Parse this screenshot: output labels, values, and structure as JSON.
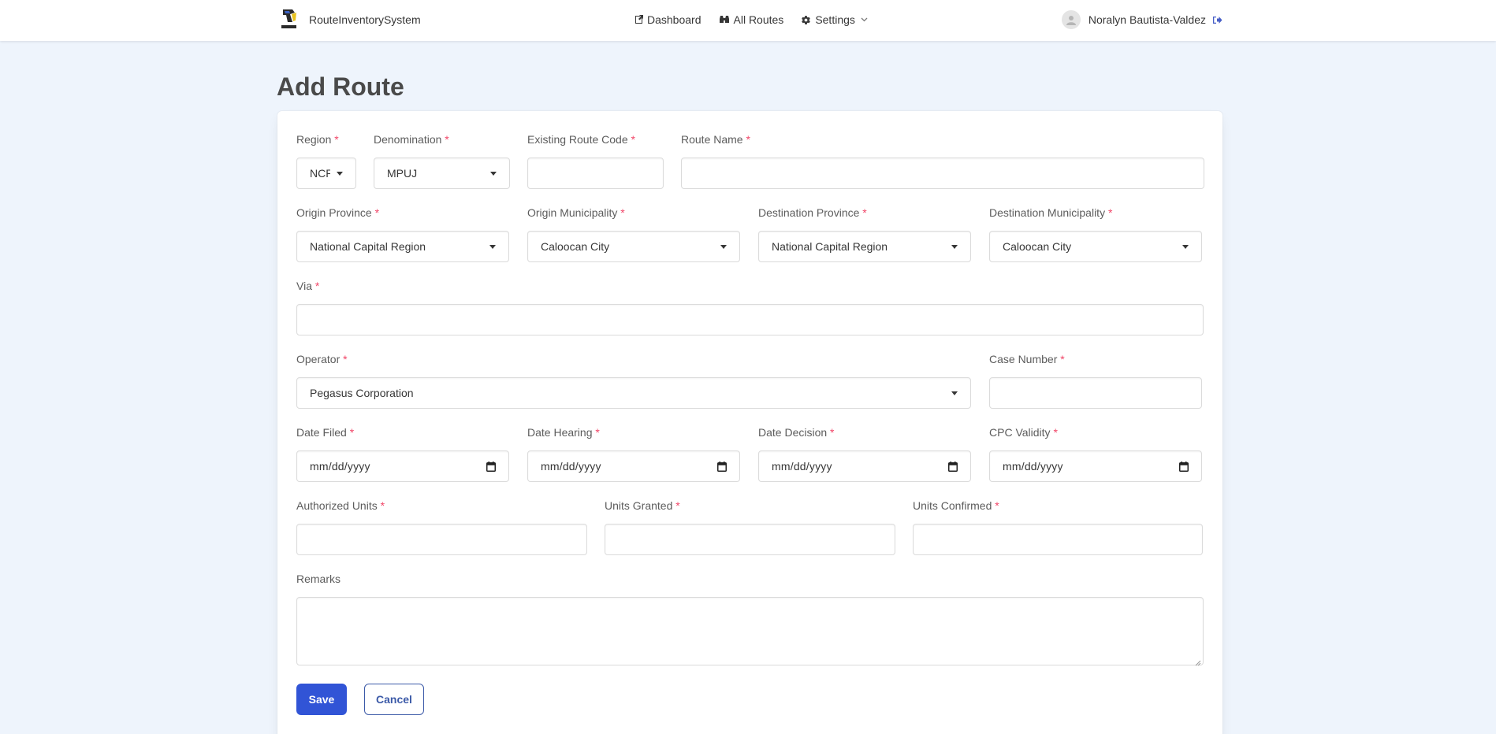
{
  "navbar": {
    "brand": "RouteInventorySystem",
    "links": {
      "dashboard": "Dashboard",
      "all_routes": "All Routes",
      "settings": "Settings"
    },
    "user_name": "Noralyn Bautista-Valdez"
  },
  "page": {
    "title": "Add Route"
  },
  "form": {
    "required_mark": "*",
    "region": {
      "label": "Region",
      "value": "NCR"
    },
    "denomination": {
      "label": "Denomination",
      "value": "MPUJ"
    },
    "existing_route_code": {
      "label": "Existing Route Code",
      "value": ""
    },
    "route_name": {
      "label": "Route Name",
      "value": ""
    },
    "origin_province": {
      "label": "Origin Province",
      "value": "National Capital Region"
    },
    "origin_municipality": {
      "label": "Origin Municipality",
      "value": "Caloocan City"
    },
    "destination_province": {
      "label": "Destination Province",
      "value": "National Capital Region"
    },
    "destination_municipality": {
      "label": "Destination Municipality",
      "value": "Caloocan City"
    },
    "via": {
      "label": "Via",
      "value": ""
    },
    "operator": {
      "label": "Operator",
      "value": "Pegasus Corporation"
    },
    "case_number": {
      "label": "Case Number",
      "value": ""
    },
    "date_filed": {
      "label": "Date Filed",
      "placeholder": "mm/dd/yyyy"
    },
    "date_hearing": {
      "label": "Date Hearing",
      "placeholder": "mm/dd/yyyy"
    },
    "date_decision": {
      "label": "Date Decision",
      "placeholder": "mm/dd/yyyy"
    },
    "cpc_validity": {
      "label": "CPC Validity",
      "placeholder": "mm/dd/yyyy"
    },
    "authorized_units": {
      "label": "Authorized Units",
      "value": ""
    },
    "units_granted": {
      "label": "Units Granted",
      "value": ""
    },
    "units_confirmed": {
      "label": "Units Confirmed",
      "value": ""
    },
    "remarks": {
      "label": "Remarks",
      "value": ""
    }
  },
  "actions": {
    "save": "Save",
    "cancel": "Cancel"
  },
  "colors": {
    "background": "#eef4fc",
    "primary": "#3154d6",
    "required": "#f14668",
    "logout_icon": "#485fc7"
  },
  "icons": {
    "dashboard": "dashboard-icon",
    "all_routes": "binoculars-icon",
    "settings": "gear-icon",
    "settings_caret": "chevron-down-icon",
    "logout": "sign-out-icon",
    "date": "calendar-icon"
  }
}
